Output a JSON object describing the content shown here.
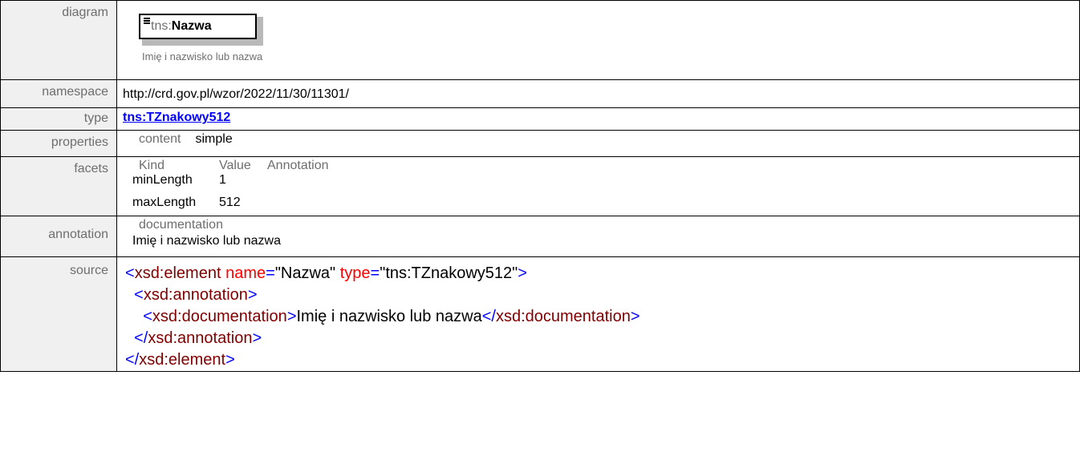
{
  "rows": {
    "diagram_label": "diagram",
    "namespace_label": "namespace",
    "type_label": "type",
    "properties_label": "properties",
    "facets_label": "facets",
    "annotation_label": "annotation",
    "source_label": "source"
  },
  "diagram": {
    "prefix": "tns:",
    "name": "Nazwa",
    "documentation": "Imię i nazwisko lub nazwa"
  },
  "namespace": "http://crd.gov.pl/wzor/2022/11/30/11301/",
  "type": "tns:TZnakowy512",
  "properties": {
    "key": "content",
    "value": "simple"
  },
  "facets": {
    "headers": [
      "Kind",
      "Value",
      "Annotation"
    ],
    "items": [
      {
        "kind": "minLength",
        "value": "1",
        "annotation": ""
      },
      {
        "kind": "maxLength",
        "value": "512",
        "annotation": ""
      }
    ]
  },
  "annotation": {
    "heading": "documentation",
    "text": "Imię i nazwisko lub nazwa"
  },
  "source": {
    "l1_open": "<",
    "l1_tag": "xsd:element",
    "l1_attr1": "name",
    "l1_eq": "=",
    "l1_val1": "\"Nazwa\"",
    "l1_attr2": "type",
    "l1_val2": "\"tns:TZnakowy512\"",
    "l1_close": ">",
    "l2_open": "<",
    "l2_tag": "xsd:annotation",
    "l2_close": ">",
    "l3_open": "<",
    "l3_tag": "xsd:documentation",
    "l3_close": ">",
    "l3_text": "Imię i nazwisko lub nazwa",
    "l3_end_open": "</",
    "l3_end_tag": "xsd:documentation",
    "l3_end_close": ">",
    "l4_open": "</",
    "l4_tag": "xsd:annotation",
    "l4_close": ">",
    "l5_open": "</",
    "l5_tag": "xsd:element",
    "l5_close": ">"
  }
}
